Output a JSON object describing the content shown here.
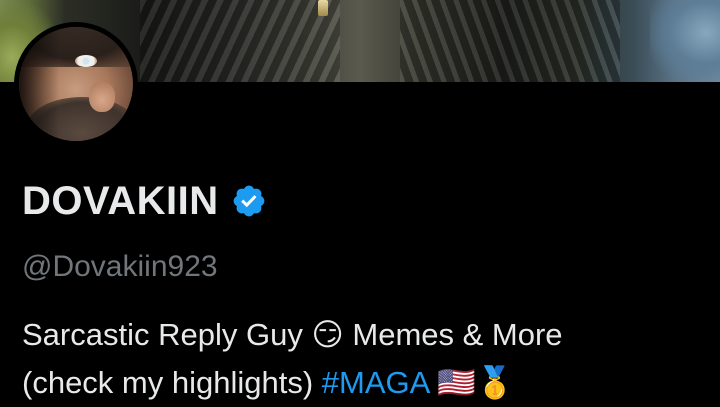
{
  "profile": {
    "display_name": "DOVAKIIN",
    "handle": "@Dovakiin923",
    "verified_icon": "verified-badge-icon",
    "bio": {
      "line1_text": "Sarcastic Reply Guy ",
      "line1_emoji": "😏",
      "line1_text2": " Memes & More",
      "line2_text": "(check my highlights) ",
      "hashtag": "#MAGA",
      "flag_emoji": "🇺🇸",
      "medal_emoji": "🥇"
    }
  },
  "colors": {
    "background": "#000000",
    "text_primary": "#e7e9ea",
    "text_secondary": "#71767b",
    "accent": "#1d9bf0"
  }
}
